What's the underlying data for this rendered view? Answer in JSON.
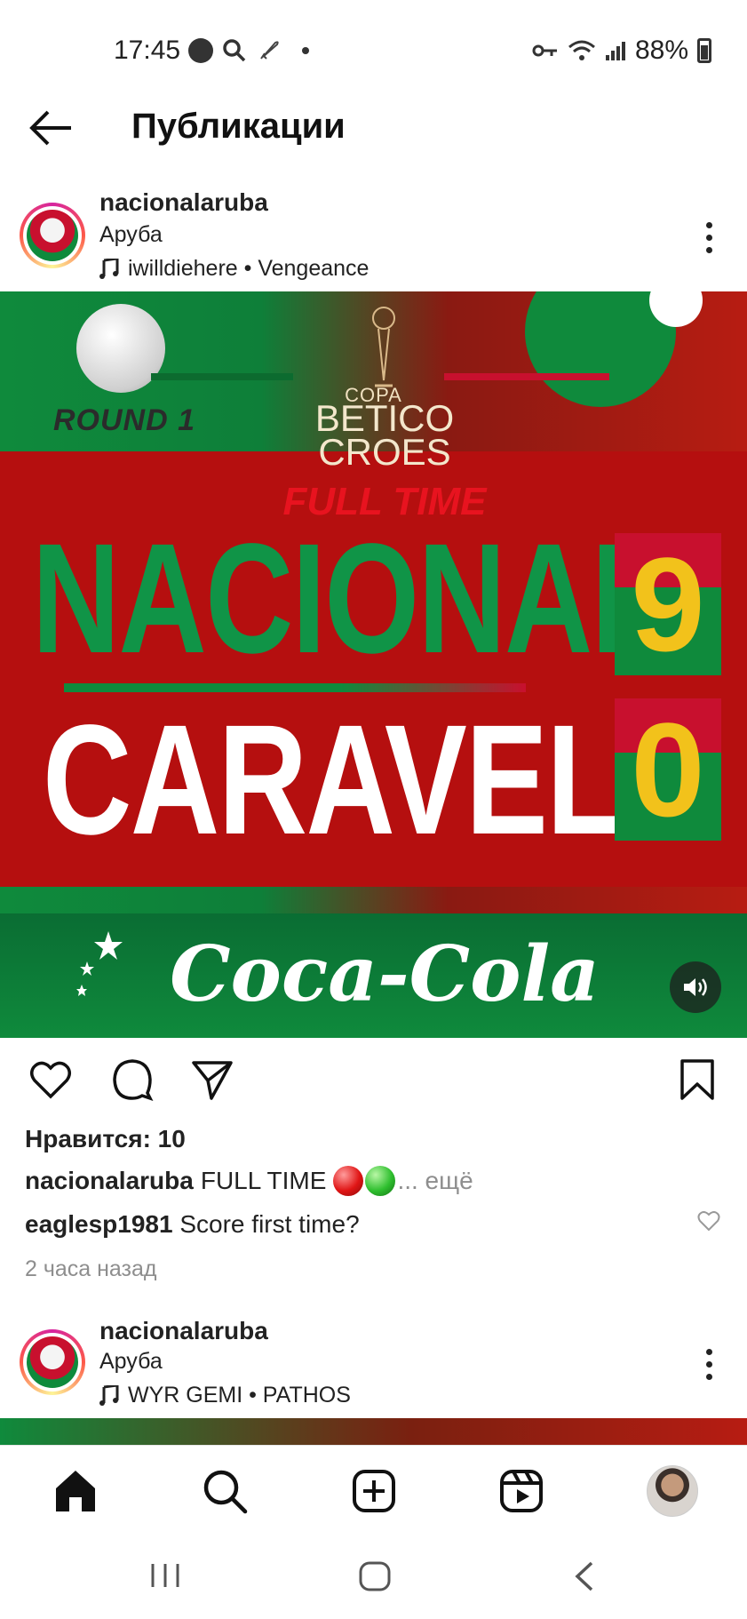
{
  "status_bar": {
    "time": "17:45",
    "battery": "88%",
    "icons": [
      "circle-icon",
      "search-icon",
      "rocket-icon",
      "dot-icon",
      "key-icon",
      "wifi-icon",
      "signal-icon",
      "battery-icon"
    ]
  },
  "header": {
    "title": "Публикации",
    "back_icon": "back-arrow-icon"
  },
  "post": {
    "username": "nacionalaruba",
    "location": "Аруба",
    "music": "iwilldiehere • Vengeance",
    "media": {
      "round": "ROUND 1",
      "copa": "COPA",
      "tournament_line1": "BETICO",
      "tournament_line2": "CROES",
      "status": "FULL TIME",
      "team1": "NACIONAL",
      "team1_score": "9",
      "team2": "CARAVEL",
      "team2_score": "0",
      "sponsor": "Coca-Cola"
    },
    "likes": "Нравится: 10",
    "caption_user": "nacionalaruba",
    "caption_text": "FULL TIME",
    "caption_more": "... ещё",
    "comment_user": "eaglesp1981",
    "comment_text": "Score first time?",
    "time_ago": "2 часа назад"
  },
  "next_post": {
    "username": "nacionalaruba",
    "location": "Аруба",
    "music": "WYR GEMI • PATHOS"
  },
  "bottom_nav": [
    "home-icon",
    "search-icon",
    "create-icon",
    "reels-icon",
    "profile-avatar"
  ],
  "system_nav": [
    "recents-icon",
    "home-button-icon",
    "back-icon"
  ],
  "colors": {
    "green": "#0f8a3c",
    "red": "#b50f0f",
    "score_yellow": "#f2c21b",
    "text": "#222222",
    "muted": "#8e8e8e"
  }
}
